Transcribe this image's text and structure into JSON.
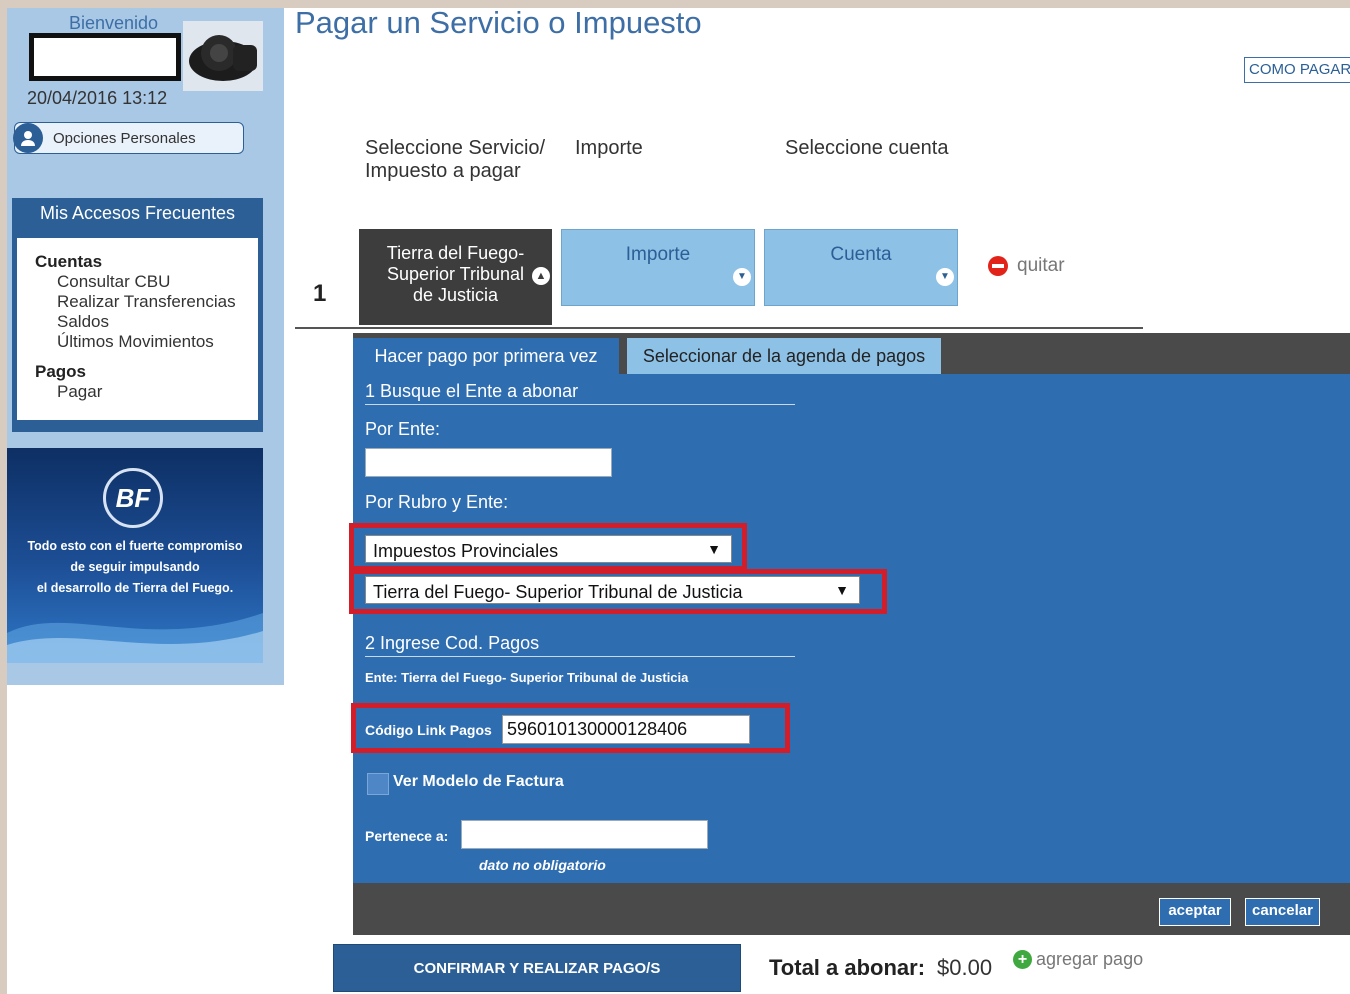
{
  "sidebar": {
    "welcome": "Bienvenido",
    "datetime": "20/04/2016 13:12",
    "personal_options": "Opciones Personales",
    "frequent": {
      "title": "Mis Accesos Frecuentes",
      "groups": [
        {
          "label": "Cuentas",
          "items": [
            "Consultar CBU",
            "Realizar Transferencias",
            "Saldos",
            "Últimos Movimientos"
          ]
        },
        {
          "label": "Pagos",
          "items": [
            "Pagar"
          ]
        }
      ]
    },
    "banner": {
      "logo": "BF",
      "lines": [
        "Todo esto con el fuerte compromiso",
        "de seguir impulsando",
        "el desarrollo de Tierra del Fuego."
      ]
    }
  },
  "header": {
    "title": "Pagar un Servicio o Impuesto",
    "how_to_pay": "COMO PAGAR"
  },
  "steps": {
    "labels": [
      "Seleccione Servicio/ Impuesto a pagar",
      "Importe",
      "Seleccione cuenta"
    ],
    "row_number": "1",
    "service_tile": "Tierra del Fuego- Superior Tribunal de Justicia",
    "amount_tile": "Importe",
    "account_tile": "Cuenta",
    "remove": "quitar"
  },
  "tabs": {
    "first_time": "Hacer pago por primera vez",
    "agenda": "Seleccionar de la agenda de pagos"
  },
  "form": {
    "section1": "1 Busque el Ente a abonar",
    "by_entity_label": "Por Ente:",
    "by_entity_value": "",
    "by_category_label": "Por Rubro y Ente:",
    "category_select": "Impuestos Provinciales",
    "entity_select": "Tierra del Fuego- Superior Tribunal de Justicia",
    "section2": "2 Ingrese Cod. Pagos",
    "entity_info": "Ente: Tierra del Fuego- Superior Tribunal de Justicia",
    "code_label": "Código Link Pagos",
    "code_value": "596010130000128406",
    "invoice_model": "Ver Modelo de Factura",
    "belongs_label": "Pertenece a:",
    "belongs_value": "",
    "optional_note": "dato no obligatorio",
    "accept": "aceptar",
    "cancel": "cancelar"
  },
  "footer": {
    "confirm": "CONFIRMAR Y REALIZAR PAGO/S",
    "total_label": "Total a abonar:",
    "total_value": "$0.00",
    "add_payment": "agregar pago"
  },
  "colors": {
    "primary_blue": "#2f6db1",
    "dark_blue": "#2b5f96",
    "light_blue": "#8ec1e6",
    "highlight_red": "#d21d2b"
  }
}
